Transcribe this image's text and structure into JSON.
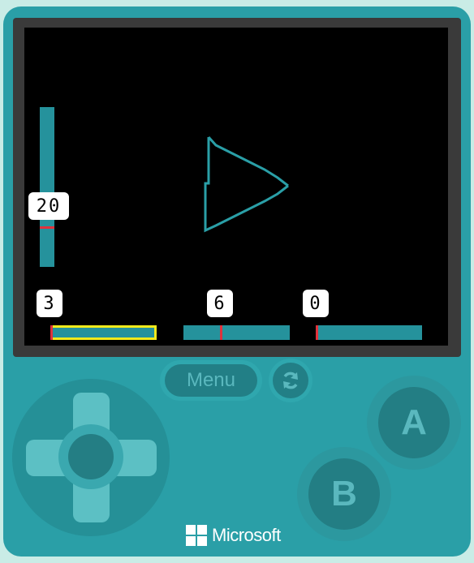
{
  "game": {
    "vertical_slider": {
      "value_label": "20",
      "level": 0.3
    },
    "sliders": [
      {
        "value_label": "3",
        "selected": true,
        "level": 0.0
      },
      {
        "value_label": "6",
        "selected": false,
        "level": 0.35
      },
      {
        "value_label": "0",
        "selected": false,
        "level": 0.0
      }
    ],
    "shape": "triangle-outline",
    "colors": {
      "slider": "#25929c",
      "marker": "#e0323c",
      "selection": "#f2ea1c",
      "triangle": "#2a9fa7"
    }
  },
  "controls": {
    "menu_label": "Menu",
    "a_label": "A",
    "b_label": "B",
    "reset_icon": "refresh-icon",
    "dpad_icon": "dpad-icon"
  },
  "brand": {
    "name": "Microsoft",
    "logo": "windows-logo-icon"
  }
}
